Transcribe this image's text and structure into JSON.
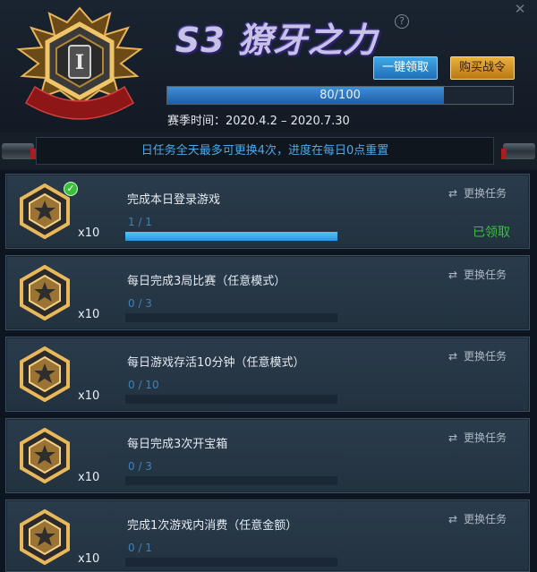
{
  "header": {
    "season_title": "S3 獠牙之力",
    "claim_all_label": "一键领取",
    "buy_pass_label": "购买战令",
    "progress_text": "80/100",
    "progress_fraction": 0.8,
    "season_time": "赛季时间：2020.4.2 – 2020.7.30",
    "rank_level": "I",
    "close_glyph": "✕",
    "help_glyph": "?"
  },
  "notice": {
    "text": "日任务全天最多可更换4次，进度在每日0点重置"
  },
  "colors": {
    "accent_blue": "#3f8fd8",
    "gold": "#d9a23a",
    "claimed_green": "#34c43a"
  },
  "tasks": [
    {
      "title": "完成本日登录游戏",
      "progress": "1 / 1",
      "fraction": 1.0,
      "reward": "x10",
      "swap_label": "更换任务",
      "status": "已领取",
      "completed": true
    },
    {
      "title": "每日完成3局比赛（任意模式）",
      "progress": "0 / 3",
      "fraction": 0,
      "reward": "x10",
      "swap_label": "更换任务",
      "status": "",
      "completed": false
    },
    {
      "title": "每日游戏存活10分钟（任意模式）",
      "progress": "0 / 10",
      "fraction": 0,
      "reward": "x10",
      "swap_label": "更换任务",
      "status": "",
      "completed": false
    },
    {
      "title": "每日完成3次开宝箱",
      "progress": "0 / 3",
      "fraction": 0,
      "reward": "x10",
      "swap_label": "更换任务",
      "status": "",
      "completed": false
    },
    {
      "title": "完成1次游戏内消费（任意金额）",
      "progress": "0 / 1",
      "fraction": 0,
      "reward": "x10",
      "swap_label": "更换任务",
      "status": "",
      "completed": false
    }
  ],
  "icons": {
    "swap": "swap-icon",
    "medal": "star-medal-icon",
    "check": "check-icon"
  }
}
